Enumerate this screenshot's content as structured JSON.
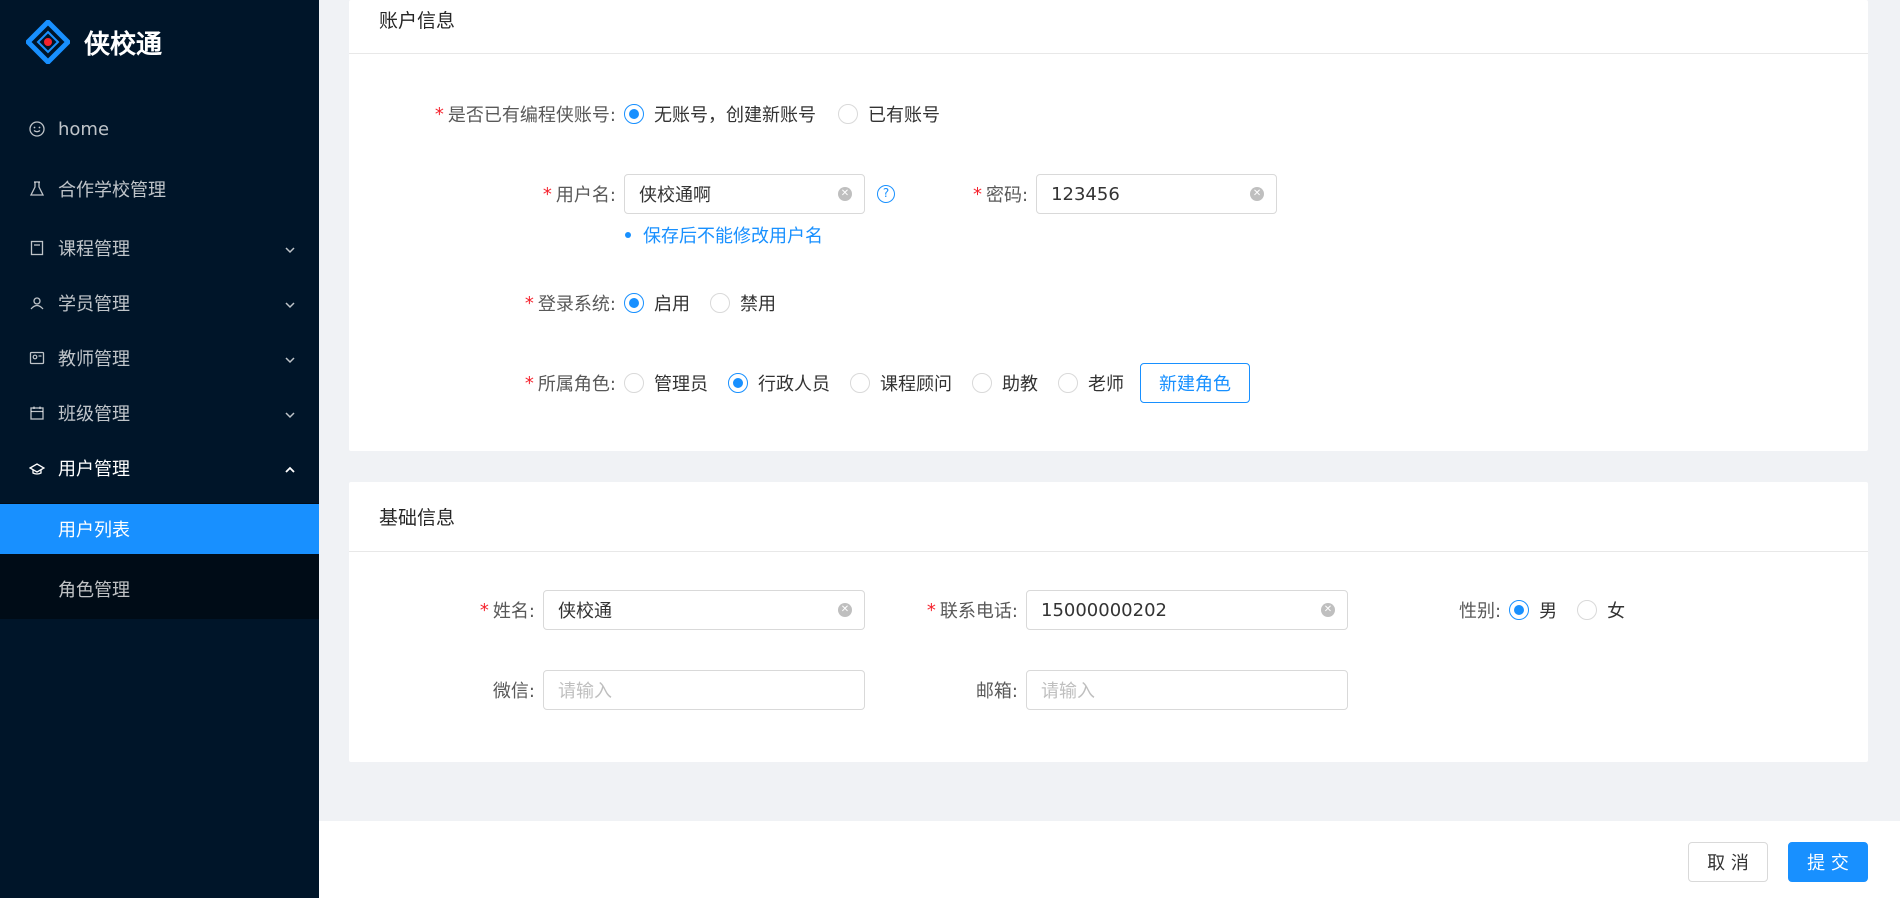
{
  "app": {
    "name": "侠校通"
  },
  "sidebar": {
    "items": [
      {
        "label": "home"
      },
      {
        "label": "合作学校管理"
      },
      {
        "label": "课程管理"
      },
      {
        "label": "学员管理"
      },
      {
        "label": "教师管理"
      },
      {
        "label": "班级管理"
      },
      {
        "label": "用户管理"
      }
    ],
    "sub_items": [
      {
        "label": "用户列表"
      },
      {
        "label": "角色管理"
      }
    ]
  },
  "account": {
    "title": "账户信息",
    "has_account_label": "是否已有编程侠账号:",
    "has_account_options": [
      "无账号，创建新账号",
      "已有账号"
    ],
    "username_label": "用户名:",
    "username_value": "侠校通啊",
    "username_hint": "保存后不能修改用户名",
    "password_label": "密码:",
    "password_value": "123456",
    "login_label": "登录系统:",
    "login_options": [
      "启用",
      "禁用"
    ],
    "role_label": "所属角色:",
    "role_options": [
      "管理员",
      "行政人员",
      "课程顾问",
      "助教",
      "老师"
    ],
    "new_role_button": "新建角色"
  },
  "basic": {
    "title": "基础信息",
    "name_label": "姓名:",
    "name_value": "侠校通",
    "phone_label": "联系电话:",
    "phone_value": "15000000202",
    "gender_label": "性别:",
    "gender_options": [
      "男",
      "女"
    ],
    "wechat_label": "微信:",
    "wechat_placeholder": "请输入",
    "email_label": "邮箱:",
    "email_placeholder": "请输入"
  },
  "footer": {
    "cancel": "取 消",
    "submit": "提 交"
  },
  "colors": {
    "primary": "#1890ff",
    "sidebar_bg": "#001529",
    "submenu_bg": "#000c17",
    "required": "#f5222d"
  }
}
